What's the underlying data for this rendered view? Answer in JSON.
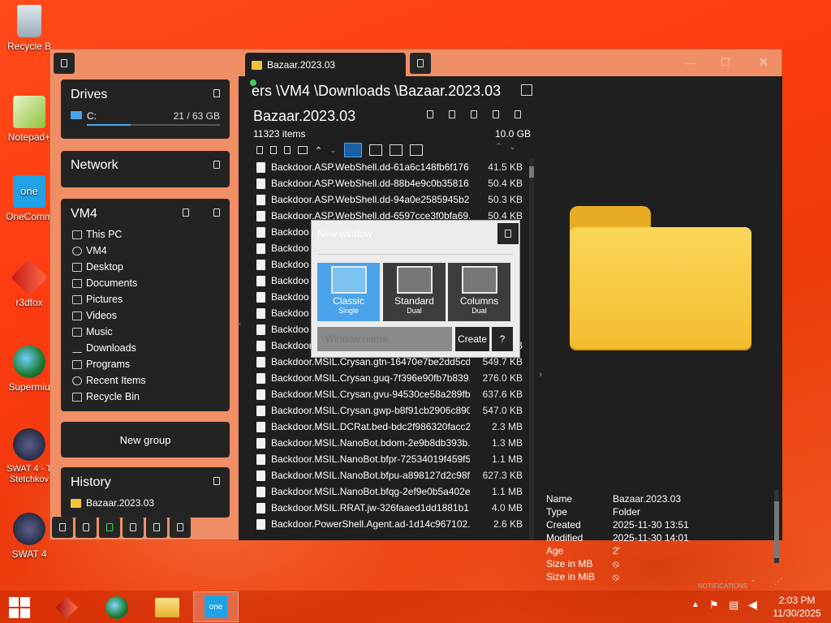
{
  "desktop": {
    "icons": [
      {
        "label": "Recycle B"
      },
      {
        "label": "Notepad+"
      },
      {
        "label": "OneComm"
      },
      {
        "label": "r3dfox"
      },
      {
        "label": "Supermiu"
      },
      {
        "label": "SWAT 4 - T\nStetchkov"
      },
      {
        "label": "SWAT 4"
      }
    ]
  },
  "window": {
    "tab_title": "Bazaar.2023.03",
    "path": "ers \\VM4 \\Downloads \\Bazaar.2023.03",
    "folder_title": "Bazaar.2023.03",
    "item_count": "11323 items",
    "total_size": "10.0 GB"
  },
  "sidebar": {
    "drives": {
      "title": "Drives",
      "drive_letter": "C:",
      "usage": "21 / 63 GB",
      "usage_fraction": 0.33
    },
    "network": {
      "title": "Network"
    },
    "vm4": {
      "title": "VM4",
      "items": [
        {
          "label": "This PC",
          "icon": "computer-icon"
        },
        {
          "label": "VM4",
          "icon": "user-icon"
        },
        {
          "label": "Desktop",
          "icon": "desktop-icon"
        },
        {
          "label": "Documents",
          "icon": "document-icon"
        },
        {
          "label": "Pictures",
          "icon": "picture-icon"
        },
        {
          "label": "Videos",
          "icon": "video-icon"
        },
        {
          "label": "Music",
          "icon": "music-icon"
        },
        {
          "label": "Downloads",
          "icon": "download-icon"
        },
        {
          "label": "Programs",
          "icon": "programs-icon"
        },
        {
          "label": "Recent Items",
          "icon": "recent-icon"
        },
        {
          "label": "Recycle Bin",
          "icon": "recycle-icon"
        }
      ]
    },
    "new_group": "New group",
    "history": {
      "title": "History",
      "items": [
        {
          "label": "Bazaar.2023.03"
        }
      ]
    }
  },
  "files": [
    {
      "name": "Backdoor.ASP.WebShell.dd-61a6c148fb6f176...",
      "size": "41.5 KB"
    },
    {
      "name": "Backdoor.ASP.WebShell.dd-88b4e9c0b35816...",
      "size": "50.4 KB"
    },
    {
      "name": "Backdoor.ASP.WebShell.dd-94a0e2585945b2...",
      "size": "50.3 KB"
    },
    {
      "name": "Backdoor.ASP.WebShell.dd-6597cce3f0bfa69...",
      "size": "50.4 KB"
    },
    {
      "name": "Backdoo",
      "size": ""
    },
    {
      "name": "Backdoo",
      "size": ""
    },
    {
      "name": "Backdoo",
      "size": ""
    },
    {
      "name": "Backdoo",
      "size": ""
    },
    {
      "name": "Backdoo",
      "size": ""
    },
    {
      "name": "Backdoo",
      "size": ""
    },
    {
      "name": "Backdoo",
      "size": ""
    },
    {
      "name": "Backdoor.MSIL.Crysan.grb-69870584fe1835b...",
      "size": "331.5 KB"
    },
    {
      "name": "Backdoor.MSIL.Crysan.gtn-16470e7be2dd5cd...",
      "size": "549.7 KB"
    },
    {
      "name": "Backdoor.MSIL.Crysan.guq-7f396e90fb7b839...",
      "size": "276.0 KB"
    },
    {
      "name": "Backdoor.MSIL.Crysan.gvu-94530ce58a289fb...",
      "size": "637.6 KB"
    },
    {
      "name": "Backdoor.MSIL.Crysan.gwp-b8f91cb2906c890...",
      "size": "547.0 KB"
    },
    {
      "name": "Backdoor.MSIL.DCRat.bed-bdc2f986320facc2...",
      "size": "2.3 MB"
    },
    {
      "name": "Backdoor.MSIL.NanoBot.bdom-2e9b8db393b...",
      "size": "1.3 MB"
    },
    {
      "name": "Backdoor.MSIL.NanoBot.bfpr-72534019f459f5...",
      "size": "1.1 MB"
    },
    {
      "name": "Backdoor.MSIL.NanoBot.bfpu-a898127d2c98f...",
      "size": "627.3 KB"
    },
    {
      "name": "Backdoor.MSIL.NanoBot.bfqg-2ef9e0b5a402e...",
      "size": "1.1 MB"
    },
    {
      "name": "Backdoor.MSIL.RRAT.jw-326faaed1dd1881b1...",
      "size": "4.0 MB"
    },
    {
      "name": "Backdoor.PowerShell.Agent.ad-1d14c967102...",
      "size": "2.6 KB"
    }
  ],
  "properties": [
    {
      "key": "Name",
      "value": "Bazaar.2023.03"
    },
    {
      "key": "Type",
      "value": "Folder"
    },
    {
      "key": "Created",
      "value": "2025-11-30  13:51"
    },
    {
      "key": "Modified",
      "value": "2025-11-30  14:01"
    },
    {
      "key": "Age",
      "value": "2'"
    },
    {
      "key": "Size in MB",
      "value": "⦸"
    },
    {
      "key": "Size in MiB",
      "value": "⦸"
    }
  ],
  "notifications_label": "NOTIFICATIONS",
  "dialog": {
    "title": "New window",
    "modes": [
      {
        "title": "Classic",
        "sub": "Single"
      },
      {
        "title": "Standard",
        "sub": "Dual"
      },
      {
        "title": "Columns",
        "sub": "Dual"
      }
    ],
    "name_placeholder": "Window name",
    "create_label": "Create",
    "help_label": "?"
  },
  "taskbar": {
    "time": "2:03 PM",
    "date": "11/30/2025"
  },
  "colors": {
    "accent": "#4aa3ea",
    "folder": "#f6c63d",
    "panel": "#232323",
    "window_bg": "#f08f65"
  }
}
